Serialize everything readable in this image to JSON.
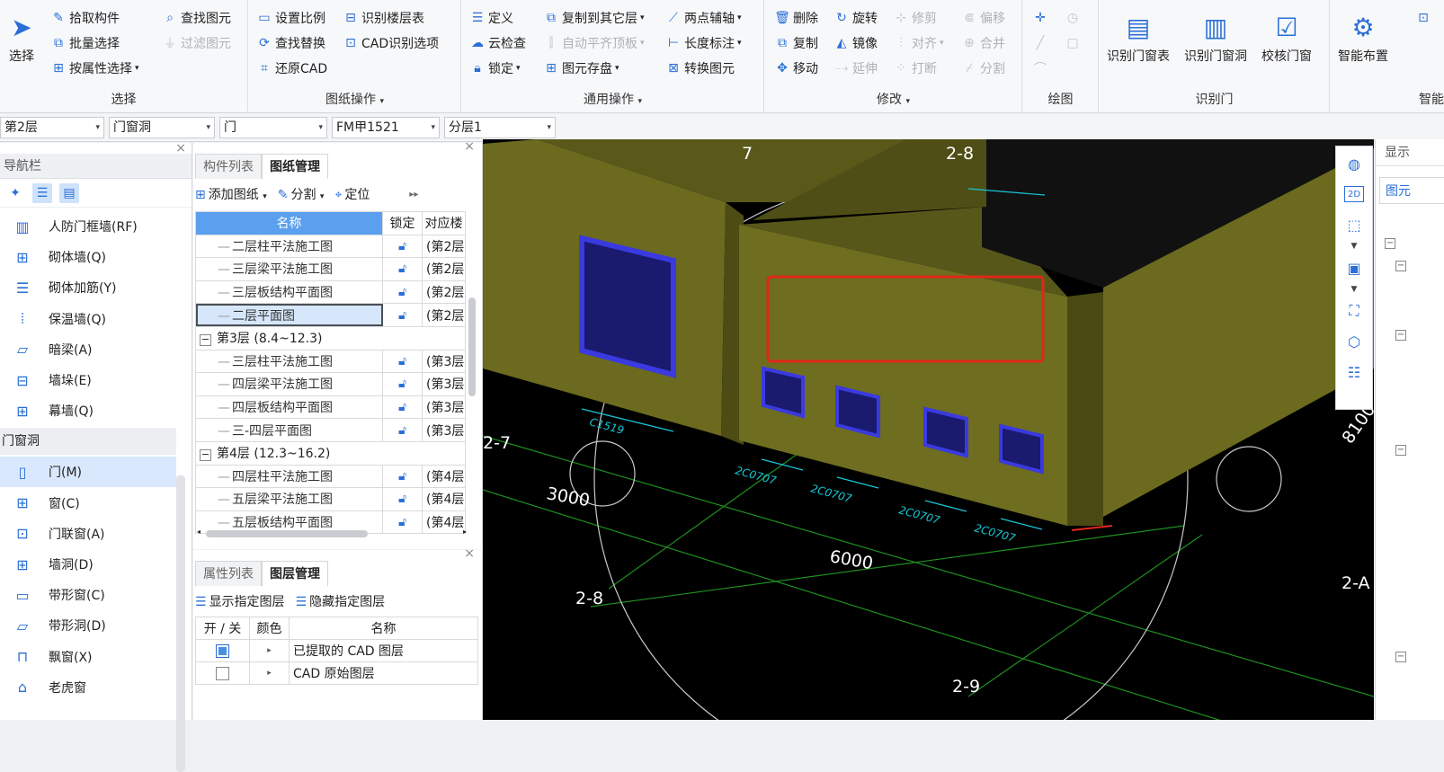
{
  "ribbon": {
    "select": {
      "big": "选择",
      "items": [
        "拾取构件",
        "批量选择",
        "按属性选择",
        "查找图元",
        "过滤图元"
      ],
      "label": "选择"
    },
    "drawing_ops": {
      "items": [
        "设置比例",
        "识别楼层表",
        "查找替换",
        "CAD识别选项",
        "还原CAD"
      ],
      "label": "图纸操作"
    },
    "common_ops": {
      "items": [
        "定义",
        "复制到其它层",
        "两点辅轴",
        "云检查",
        "自动平齐顶板",
        "长度标注",
        "锁定",
        "图元存盘",
        "转换图元"
      ],
      "label": "通用操作"
    },
    "modify": {
      "items": [
        "删除",
        "旋转",
        "修剪",
        "偏移",
        "复制",
        "镜像",
        "对齐",
        "合并",
        "移动",
        "延伸",
        "打断",
        "分割"
      ],
      "label": "修改"
    },
    "draw": {
      "label": "绘图"
    },
    "recognize": {
      "items": [
        "识别门窗表",
        "识别门窗洞",
        "校核门窗"
      ],
      "label": "识别门"
    },
    "smart": {
      "items": [
        "智能布置"
      ],
      "label": "智能"
    }
  },
  "combos": [
    "第2层",
    "门窗洞",
    "门",
    "FM甲1521",
    "分层1"
  ],
  "nav": {
    "title": "导航栏",
    "items": [
      {
        "label": "人防门框墙(RF)",
        "icon": "door-frame-wall-icon"
      },
      {
        "label": "砌体墙(Q)",
        "icon": "masonry-wall-icon"
      },
      {
        "label": "砌体加筋(Y)",
        "icon": "wall-rebar-icon"
      },
      {
        "label": "保温墙(Q)",
        "icon": "insulation-wall-icon"
      },
      {
        "label": "暗梁(A)",
        "icon": "hidden-beam-icon"
      },
      {
        "label": "墙垛(E)",
        "icon": "wall-pier-icon"
      },
      {
        "label": "幕墙(Q)",
        "icon": "curtain-wall-icon"
      }
    ],
    "category": "门窗洞",
    "items2": [
      {
        "label": "门(M)",
        "icon": "door-icon",
        "selected": true
      },
      {
        "label": "窗(C)",
        "icon": "window-icon"
      },
      {
        "label": "门联窗(A)",
        "icon": "door-window-icon"
      },
      {
        "label": "墙洞(D)",
        "icon": "wall-opening-icon"
      },
      {
        "label": "带形窗(C)",
        "icon": "strip-window-icon"
      },
      {
        "label": "带形洞(D)",
        "icon": "strip-opening-icon"
      },
      {
        "label": "飘窗(X)",
        "icon": "bay-window-icon"
      },
      {
        "label": "老虎窗",
        "icon": "dormer-icon"
      }
    ]
  },
  "drawings": {
    "tabs": [
      "构件列表",
      "图纸管理"
    ],
    "tools": [
      "添加图纸",
      "分割",
      "定位"
    ],
    "headers": [
      "名称",
      "锁定",
      "对应楼"
    ],
    "rows": [
      {
        "type": "item",
        "name": "二层柱平法施工图",
        "floor": "(第2层"
      },
      {
        "type": "item",
        "name": "三层梁平法施工图",
        "floor": "(第2层"
      },
      {
        "type": "item",
        "name": "三层板结构平面图",
        "floor": "(第2层"
      },
      {
        "type": "item",
        "name": "二层平面图",
        "floor": "(第2层",
        "selected": true
      },
      {
        "type": "group",
        "name": "第3层 (8.4~12.3)"
      },
      {
        "type": "item",
        "name": "三层柱平法施工图",
        "floor": "(第3层"
      },
      {
        "type": "item",
        "name": "四层梁平法施工图",
        "floor": "(第3层"
      },
      {
        "type": "item",
        "name": "四层板结构平面图",
        "floor": "(第3层"
      },
      {
        "type": "item",
        "name": "三-四层平面图",
        "floor": "(第3层"
      },
      {
        "type": "group",
        "name": "第4层 (12.3~16.2)"
      },
      {
        "type": "item",
        "name": "四层柱平法施工图",
        "floor": "(第4层"
      },
      {
        "type": "item",
        "name": "五层梁平法施工图",
        "floor": "(第4层"
      },
      {
        "type": "item",
        "name": "五层板结构平面图",
        "floor": "(第4层"
      }
    ]
  },
  "layers": {
    "tabs": [
      "属性列表",
      "图层管理"
    ],
    "tools": [
      "显示指定图层",
      "隐藏指定图层"
    ],
    "headers": [
      "开 / 关",
      "颜色",
      "名称"
    ],
    "rows": [
      {
        "on": true,
        "name": "已提取的 CAD 图层"
      },
      {
        "on": false,
        "name": "CAD 原始图层"
      }
    ]
  },
  "viewport": {
    "labels": [
      "2-8",
      "7",
      "2-7",
      "2-8",
      "2-9",
      "2-A",
      "8100",
      "3000",
      "6000"
    ],
    "window_tags": [
      "C1519",
      "2C0707",
      "2C0707",
      "2C0707",
      "2C0707"
    ]
  },
  "right_panel": {
    "title": "显示",
    "tab": "图元"
  },
  "colors": {
    "wall": "#6b6a1e",
    "window": "#2a2aa8",
    "axis": "#1f8f1f",
    "tag": "#17c7d6",
    "highlight": "#e02818",
    "accent": "#2a6fd6"
  }
}
